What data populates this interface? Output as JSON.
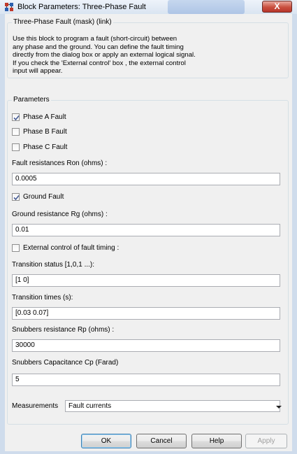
{
  "window": {
    "title": "Block Parameters: Three-Phase Fault",
    "close_glyph": "X",
    "icon": "simulink-block-icon"
  },
  "description": {
    "group_title": "Three-Phase Fault (mask) (link)",
    "lines": [
      "Use this block to program a fault (short-circuit) between",
      "any phase and the ground. You can define the fault timing",
      "directly from the dialog box or apply an external logical signal.",
      "If you check the 'External control' box , the external control",
      "input will appear."
    ]
  },
  "parameters": {
    "group_title": "Parameters",
    "phase_a": {
      "label": "Phase A Fault",
      "checked": true
    },
    "phase_b": {
      "label": "Phase B Fault",
      "checked": false
    },
    "phase_c": {
      "label": "Phase C Fault",
      "checked": false
    },
    "fault_resistance": {
      "label": "Fault resistances  Ron (ohms) :",
      "value": "0.0005"
    },
    "ground_fault": {
      "label": "Ground Fault",
      "checked": true
    },
    "ground_resistance": {
      "label": "Ground resistance Rg (ohms) :",
      "value": "0.01"
    },
    "external_control": {
      "label": "External control of fault timing :",
      "checked": false
    },
    "transition_status": {
      "label": "Transition status [1,0,1 ...):",
      "value": "[1 0]"
    },
    "transition_times": {
      "label": "Transition times (s):",
      "value": "[0.03 0.07]"
    },
    "snubber_resistance": {
      "label": "Snubbers resistance Rp (ohms) :",
      "value": "30000"
    },
    "snubber_capacitance": {
      "label": "Snubbers Capacitance Cp (Farad)",
      "value": "5"
    },
    "measurements": {
      "label": "Measurements",
      "selected": "Fault currents"
    }
  },
  "buttons": {
    "ok": "OK",
    "cancel": "Cancel",
    "help": "Help",
    "apply": "Apply"
  },
  "colors": {
    "client_bg": "#f0f0f0",
    "frame": "#cfdcec",
    "close_button": "#c9503f",
    "check_mark": "#4a5f97"
  }
}
